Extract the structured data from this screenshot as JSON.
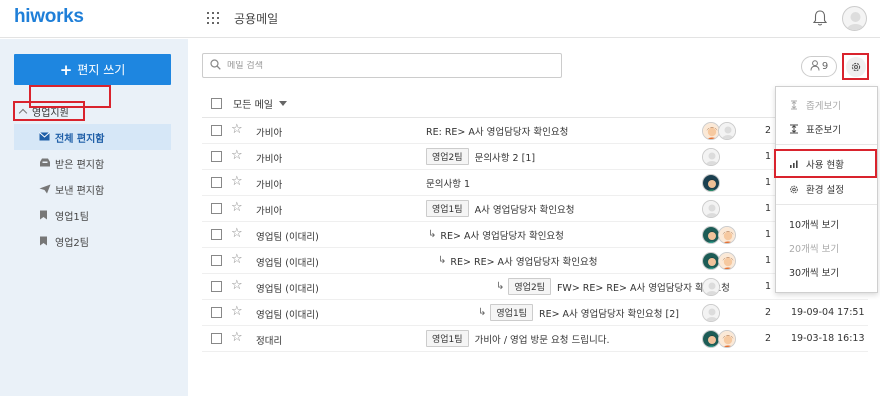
{
  "header": {
    "logo": "hiworks",
    "app_title": "공용메일"
  },
  "sidebar": {
    "compose_label": "편지 쓰기",
    "group_label": "영업지원",
    "items": [
      {
        "label": "전체 편지함",
        "icon": "envelope-icon",
        "active": true
      },
      {
        "label": "받은 편지함",
        "icon": "inbox-icon",
        "active": false
      },
      {
        "label": "보낸 편지함",
        "icon": "paper-plane-icon",
        "active": false
      },
      {
        "label": "영업1팀",
        "icon": "bookmark-icon",
        "active": false
      },
      {
        "label": "영업2팀",
        "icon": "bookmark-icon",
        "active": false
      }
    ]
  },
  "toolbar": {
    "search_placeholder": "메일 검색",
    "people_count": "9"
  },
  "list": {
    "filter_label": "모든 메일",
    "rows": [
      {
        "sender": "가비아",
        "tag": "",
        "indent": 0,
        "reply": false,
        "subject": "RE: RE> A사 영업담당자 확인요청",
        "count": "2",
        "date": ""
      },
      {
        "sender": "가비아",
        "tag": "영업2팀",
        "indent": 0,
        "reply": false,
        "subject": "문의사항 2 [1]",
        "count": "1",
        "date": ""
      },
      {
        "sender": "가비아",
        "tag": "",
        "indent": 0,
        "reply": false,
        "subject": "문의사항 1",
        "count": "1",
        "date": ""
      },
      {
        "sender": "가비아",
        "tag": "영업1팀",
        "indent": 0,
        "reply": false,
        "subject": "A사 영업담당자 확인요청",
        "count": "1",
        "date": ""
      },
      {
        "sender": "영업팀 (이대리)",
        "tag": "",
        "indent": 1,
        "reply": true,
        "subject": "RE> A사 영업담당자 확인요청",
        "count": "1",
        "date": ""
      },
      {
        "sender": "영업팀 (이대리)",
        "tag": "",
        "indent": 2,
        "reply": true,
        "subject": "RE> RE> A사 영업담당자 확인요청",
        "count": "1",
        "date": ""
      },
      {
        "sender": "영업팀 (이대리)",
        "tag": "영업2팀",
        "indent": 1,
        "reply": true,
        "subject": "FW> RE> RE> A사 영업담당자 확인요청",
        "count": "1",
        "date": ""
      },
      {
        "sender": "영업팀 (이대리)",
        "tag": "영업1팀",
        "indent": 0,
        "reply": true,
        "subject": "RE> A사 영업담당자 확인요청 [2]",
        "count": "2",
        "date": "19-09-04 17:51"
      },
      {
        "sender": "정대리",
        "tag": "영업1팀",
        "indent": 0,
        "reply": false,
        "subject": "가비아 / 영업 방문 요청 드립니다.",
        "count": "2",
        "date": "19-03-18 16:13"
      }
    ]
  },
  "menu": {
    "items": [
      {
        "label": "좁게보기",
        "icon": "compact-view-icon",
        "disabled": true
      },
      {
        "label": "표준보기",
        "icon": "standard-view-icon",
        "disabled": false
      },
      {
        "label": "사용 현황",
        "icon": "bar-chart-icon",
        "disabled": false
      },
      {
        "label": "환경 설정",
        "icon": "gear-icon",
        "disabled": false
      },
      {
        "label": "10개씩 보기",
        "icon": "",
        "disabled": false
      },
      {
        "label": "20개씩 보기",
        "icon": "",
        "disabled": true
      },
      {
        "label": "30개씩 보기",
        "icon": "",
        "disabled": false
      }
    ]
  },
  "colors": {
    "brand": "#1f7fd8",
    "compose": "#1e86e0",
    "highlight": "#d9232d",
    "sidebar_bg": "#eaf1f8",
    "active_bg": "#d6e7f7"
  }
}
